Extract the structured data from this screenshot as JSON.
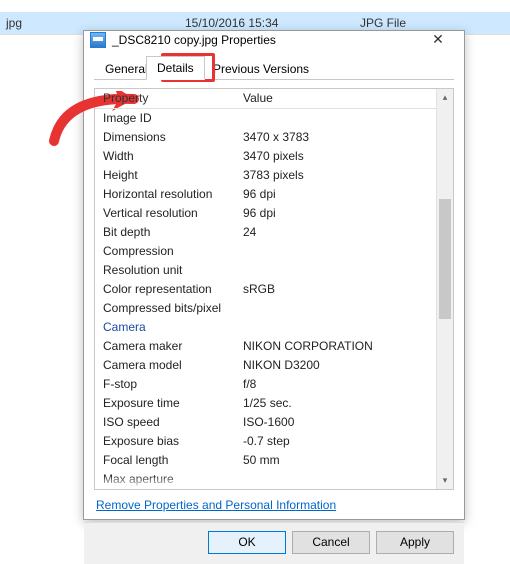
{
  "background": {
    "filename": "jpg",
    "date": "15/10/2016 15:34",
    "type": "JPG File"
  },
  "dialog": {
    "title": "_DSC8210 copy.jpg Properties",
    "close": "✕",
    "tabs": {
      "general": "General",
      "details": "Details",
      "previous": "Previous Versions"
    },
    "header": {
      "prop": "Property",
      "val": "Value"
    },
    "rows": [
      {
        "label": "Image ID",
        "value": ""
      },
      {
        "label": "Dimensions",
        "value": "3470 x 3783"
      },
      {
        "label": "Width",
        "value": "3470 pixels"
      },
      {
        "label": "Height",
        "value": "3783 pixels"
      },
      {
        "label": "Horizontal resolution",
        "value": "96 dpi"
      },
      {
        "label": "Vertical resolution",
        "value": "96 dpi"
      },
      {
        "label": "Bit depth",
        "value": "24"
      },
      {
        "label": "Compression",
        "value": ""
      },
      {
        "label": "Resolution unit",
        "value": ""
      },
      {
        "label": "Color representation",
        "value": "sRGB"
      },
      {
        "label": "Compressed bits/pixel",
        "value": ""
      }
    ],
    "section_camera": "Camera",
    "rows2": [
      {
        "label": "Camera maker",
        "value": "NIKON CORPORATION"
      },
      {
        "label": "Camera model",
        "value": "NIKON D3200"
      },
      {
        "label": "F-stop",
        "value": "f/8"
      },
      {
        "label": "Exposure time",
        "value": "1/25 sec."
      },
      {
        "label": "ISO speed",
        "value": "ISO-1600"
      },
      {
        "label": "Exposure bias",
        "value": "-0.7 step"
      },
      {
        "label": "Focal length",
        "value": "50 mm"
      },
      {
        "label": "Max aperture",
        "value": ""
      }
    ],
    "remove_link": "Remove Properties and Personal Information",
    "buttons": {
      "ok": "OK",
      "cancel": "Cancel",
      "apply": "Apply"
    }
  }
}
